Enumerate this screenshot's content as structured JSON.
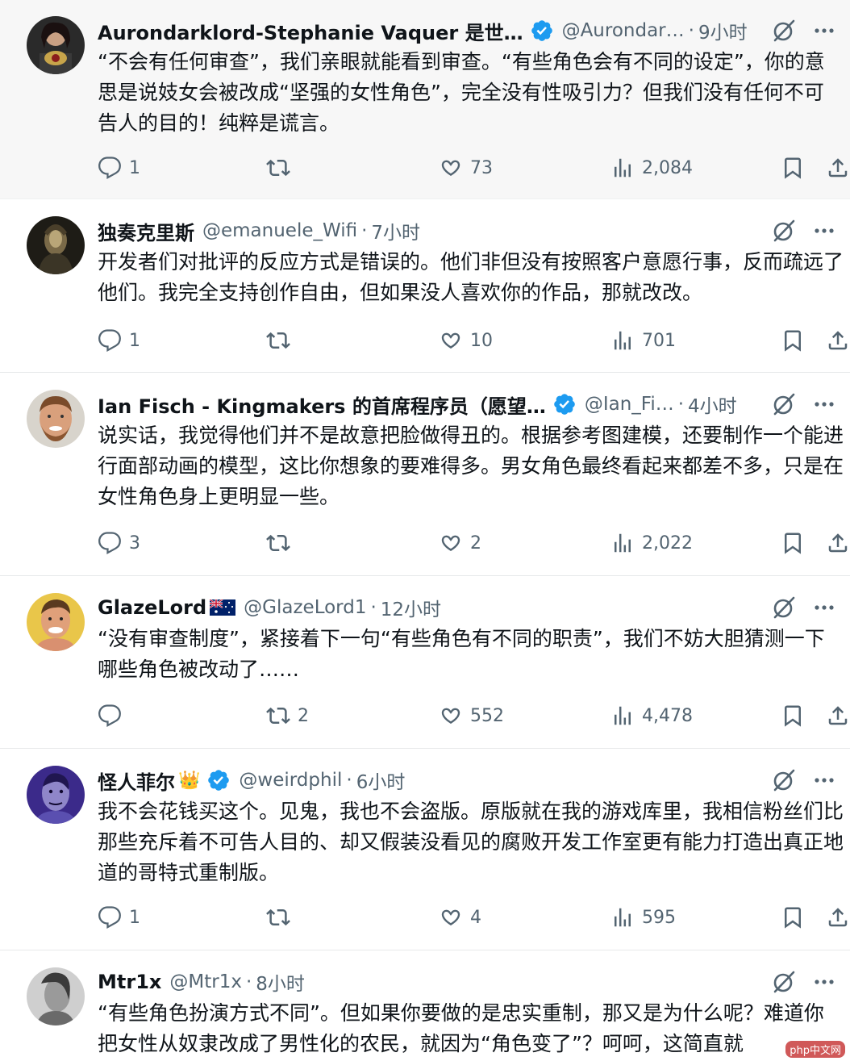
{
  "colors": {
    "verified": "#1d9bf0",
    "text_primary": "#0f1419",
    "text_secondary": "#536471",
    "divider": "#e7e9ea",
    "highlight_bg": "#f7f7f7"
  },
  "tweets": [
    {
      "name": "Aurondarklord-Stephanie Vaquer 是世…",
      "verified": true,
      "handle": "@Aurondar…",
      "sep": "·",
      "time": "9小时",
      "text": "“不会有任何审查”，我们亲眼就能看到审查。“有些角色会有不同的设定”，你的意思是说妓女会被改成“坚强的女性角色”，完全没有性吸引力？但我们没有任何不可告人的目的！纯粹是谎言。",
      "replies": "1",
      "reposts": "",
      "likes": "73",
      "views": "2,084"
    },
    {
      "name": "独奏克里斯",
      "verified": false,
      "handle": "@emanuele_Wifi",
      "sep": "·",
      "time": "7小时",
      "text": "开发者们对批评的反应方式是错误的。他们非但没有按照客户意愿行事，反而疏远了他们。我完全支持创作自由，但如果没人喜欢你的作品，那就改改。",
      "replies": "1",
      "reposts": "",
      "likes": "10",
      "views": "701"
    },
    {
      "name": "Ian Fisch - Kingmakers 的首席程序员（愿望…",
      "verified": true,
      "handle": "@Ian_Fi…",
      "sep": "·",
      "time": "4小时",
      "text": "说实话，我觉得他们并不是故意把脸做得丑的。根据参考图建模，还要制作一个能进行面部动画的模型，这比你想象的要难得多。男女角色最终看起来都差不多，只是在女性角色身上更明显一些。",
      "replies": "3",
      "reposts": "",
      "likes": "2",
      "views": "2,022"
    },
    {
      "name": "GlazeLord",
      "verified": false,
      "flag": "australia-flag",
      "handle": "@GlazeLord1",
      "sep": "·",
      "time": "12小时",
      "text": "“没有审查制度”，紧接着下一句“有些角色有不同的职责”，我们不妨大胆猜测一下哪些角色被改动了……",
      "replies": "",
      "reposts": "2",
      "likes": "552",
      "views": "4,478"
    },
    {
      "name": "怪人菲尔",
      "crown": "👑",
      "verified": true,
      "handle": "@weirdphil",
      "sep": "·",
      "time": "6小时",
      "text": "我不会花钱买这个。见鬼，我也不会盗版。原版就在我的游戏库里，我相信粉丝们比那些充斥着不可告人目的、却又假装没看见的腐败开发工作室更有能力打造出真正地道的哥特式重制版。",
      "replies": "1",
      "reposts": "",
      "likes": "4",
      "views": "595"
    },
    {
      "name": "Mtr1x",
      "verified": false,
      "handle": "@Mtr1x",
      "sep": "·",
      "time": "8小时",
      "text": "“有些角色扮演方式不同”。但如果你要做的是忠实重制，那又是为什么呢？难道你把女性从奴隶改成了男性化的农民，就因为“角色变了”？呵呵，这简直就",
      "replies": "",
      "reposts": "",
      "likes": "",
      "views": ""
    }
  ],
  "watermark": "php中文网"
}
